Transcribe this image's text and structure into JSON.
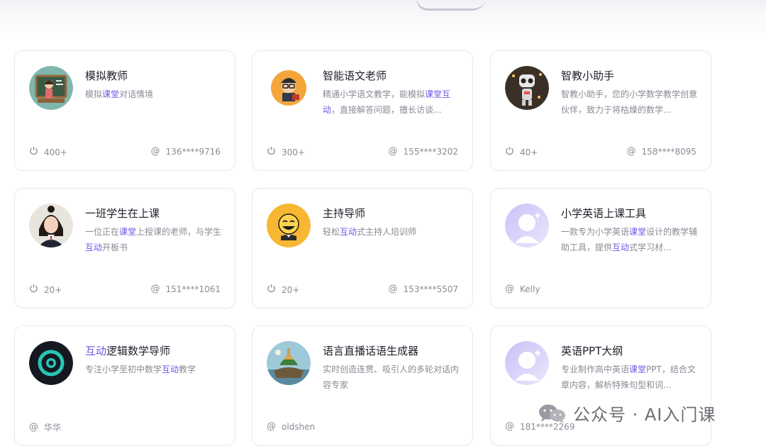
{
  "cards": [
    {
      "title_parts": [
        "模拟教师"
      ],
      "desc_parts": [
        "模拟",
        "课堂",
        "对话情境"
      ],
      "uses": "400+",
      "author": "136****9716"
    },
    {
      "title_parts": [
        "智能语文老师"
      ],
      "desc_parts": [
        "精通小学语文教学，能模拟",
        "课堂",
        "",
        "互动",
        "，直接解答问题，擅长访谈..."
      ],
      "uses": "300+",
      "author": "155****3202"
    },
    {
      "title_parts": [
        "智教小助手"
      ],
      "desc_parts": [
        "智教小助手，您的小学数学教学创意伙伴，致力于将枯燥的数学..."
      ],
      "uses": "40+",
      "author": "158****8095"
    },
    {
      "title_parts": [
        "一班学生在上课"
      ],
      "desc_parts": [
        "一位正在",
        "课堂",
        "上授课的老师，与学生",
        "互动",
        "开板书"
      ],
      "uses": "20+",
      "author": "151****1061"
    },
    {
      "title_parts": [
        "主持导师"
      ],
      "desc_parts": [
        "轻松",
        "互动",
        "式主持人培训师"
      ],
      "uses": "20+",
      "author": "153****5507"
    },
    {
      "title_parts": [
        "小学英语上课工具"
      ],
      "desc_parts": [
        "一款专为小学英语",
        "课堂",
        "设计的教学辅助工具，提供",
        "互动",
        "式学习材..."
      ],
      "uses": "",
      "author": "Kelly"
    },
    {
      "title_parts": [
        "",
        "互动",
        "逻辑数学导师"
      ],
      "desc_parts": [
        "专注小学至初中数学",
        "互动",
        "教学"
      ],
      "uses": "",
      "author": "华华"
    },
    {
      "title_parts": [
        "语言直播话语生成器"
      ],
      "desc_parts": [
        "实时创造连贯、吸引人的多轮对话内容专家"
      ],
      "uses": "",
      "author": "oldshen"
    },
    {
      "title_parts": [
        "英语PPT大纲"
      ],
      "desc_parts": [
        "专业制作高中英语",
        "课堂",
        "PPT，结合文章内容，解析特殊句型和词..."
      ],
      "uses": "",
      "author": "181****2269"
    }
  ],
  "avatars": [
    "teacher-chalkboard-avatar",
    "glasses-teacher-avatar",
    "robot-avatar",
    "student-girl-avatar",
    "emoji-host-avatar",
    "default-user-avatar",
    "ring-logo-avatar",
    "island-painting-avatar",
    "default-user-avatar"
  ],
  "icons": {
    "uses": "power-icon",
    "author": "at-icon"
  },
  "colors": {
    "highlight": "#6b57e6",
    "muted": "#8a8a96",
    "title": "#1f1f29",
    "border": "#e8e8ee"
  },
  "watermark": {
    "text": "公众号 · AI入门课",
    "icon": "wechat-icon"
  }
}
